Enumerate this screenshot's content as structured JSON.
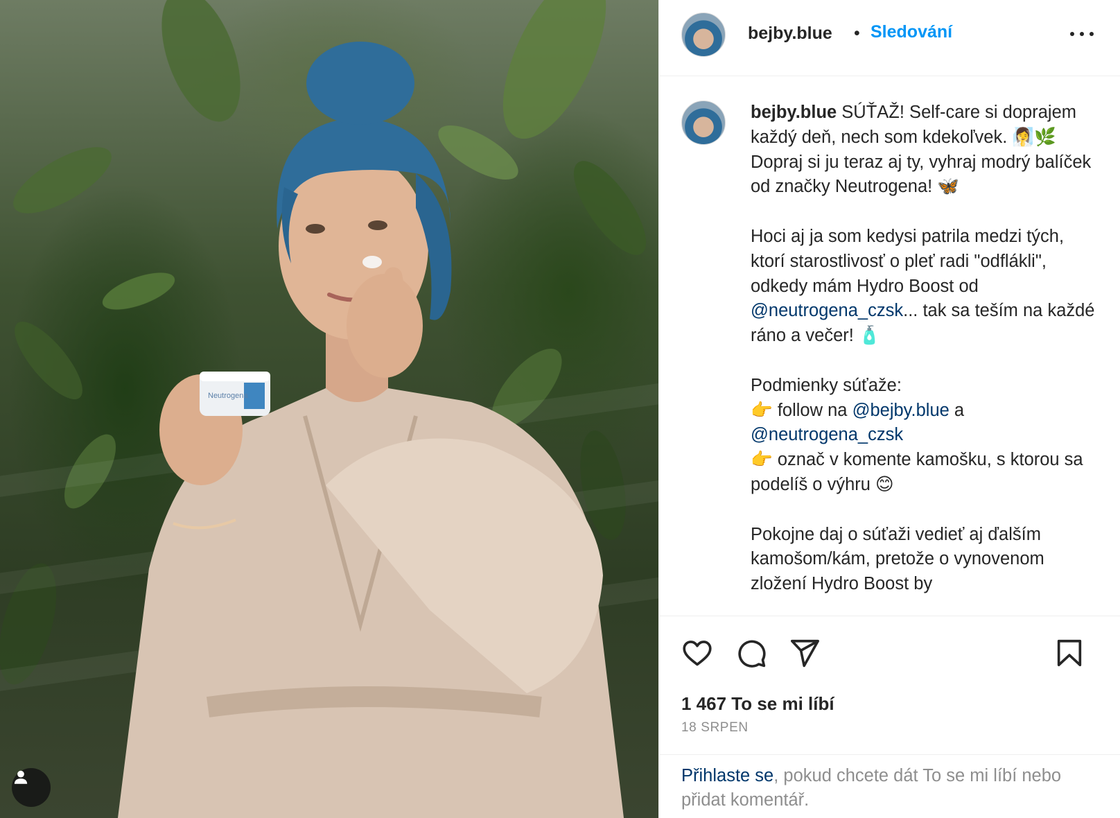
{
  "post": {
    "username": "bejby.blue",
    "follow_label": "Sledování",
    "separator": "•",
    "photo_alt": "bejby.blue post photo",
    "product_label": "Neutrogena"
  },
  "caption": {
    "username": "bejby.blue",
    "p1": " SÚŤAŽ! Self-care si doprajem každý deň, nech som kdekoľvek. 🧖‍♀️🌿 Dopraj si ju teraz aj ty, vyhraj modrý balíček od značky Neutrogena! 🦋",
    "p2a": "Hoci aj ja som kedysi patrila medzi tých, ktorí starostlivosť o pleť radi \"odflákli\", odkedy mám Hydro Boost od ",
    "mention1": "@neutrogena_czsk",
    "p2b": "... tak sa teším na každé ráno a večer! 🧴",
    "p3_title": "Podmienky súťaže:",
    "bullet1a": "👉 follow na ",
    "mention2": "@bejby.blue",
    "bullet1b": " a ",
    "mention3": "@neutrogena_czsk",
    "bullet2": "👉 označ v komente kamošku, s ktorou sa podelíš o výhru 😊",
    "p4": "Pokojne daj o súťaži vedieť aj ďalším kamošom/kám, pretože o vynovenom zložení Hydro Boost by"
  },
  "stats": {
    "likes": "1 467 To se mi líbí",
    "date": "18 SRPEN"
  },
  "login": {
    "link": "Přihlaste se",
    "rest": ", pokud chcete dát To se mi líbí nebo přidat komentář."
  },
  "icons": {
    "like": "heart-icon",
    "comment": "comment-icon",
    "share": "share-icon",
    "save": "bookmark-icon",
    "more": "more-icon",
    "user": "user-icon"
  },
  "colors": {
    "link_blue": "#0095f6",
    "mention": "#00376b",
    "text": "#262626",
    "muted": "#8e8e8e"
  }
}
